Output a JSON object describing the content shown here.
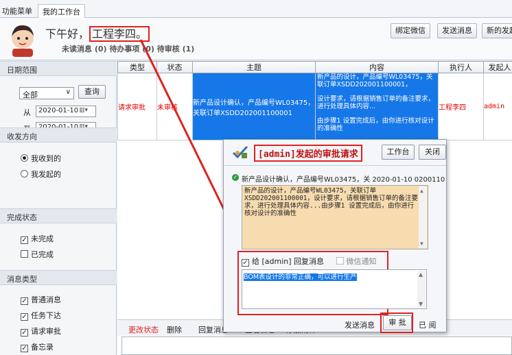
{
  "tabs": [
    {
      "label": "功能菜单"
    },
    {
      "label": "我的工作台"
    }
  ],
  "header": {
    "greeting": "下午好，",
    "username": "工程李四。",
    "stats": "未读消息 (0) 待办事项 (0)  待审核 (1)",
    "buttons": [
      "绑定微信",
      "发送消息",
      "新的发起"
    ]
  },
  "sidebar": {
    "date_range": {
      "title": "日期范围",
      "select_value": "全部",
      "query_label": "查询",
      "from_label": "从",
      "from_value": "2020-01-10",
      "to_label": "至",
      "to_value": "2020-01-10"
    },
    "direction": {
      "title": "收发方向",
      "options": [
        "我收到的",
        "我发起的"
      ],
      "selected": 0
    },
    "status": {
      "title": "完成状态",
      "options": [
        "未完成",
        "已完成"
      ],
      "checked": [
        true,
        false
      ]
    },
    "msg_type": {
      "title": "消息类型",
      "options": [
        "普通消息",
        "任务下达",
        "请求审批",
        "备忘录"
      ],
      "checked": [
        true,
        true,
        true,
        true
      ]
    }
  },
  "table": {
    "headers": [
      "类型",
      "状态",
      "主题",
      "内容",
      "执行人",
      "发起人"
    ],
    "rows": [
      {
        "type": "请求审批",
        "status": "未审核",
        "subject": "新产品设计确认，产品编号WL03475，关联订单XSDD202001100001",
        "content": [
          "新产品的设计，产品编号WL03475，关联订单XSDD202001100001，",
          "设计要求，请根据销售订单的备注要求，进行处理具体内容...",
          "由步骤1 设置完成后，由你进行核对设计的准确性"
        ],
        "executor": "工程李四",
        "initiator": "admin"
      }
    ]
  },
  "bottom": {
    "actions": [
      "更改状态",
      "删除",
      "回复消息",
      "查看日志",
      "添加附件"
    ]
  },
  "popup": {
    "title": "[admin]发起的审批请求",
    "btn_workbench": "工作台",
    "btn_close": "关闭",
    "info": "新产品设计确认，产品编号WL03475，关 2020-01-10 02001100",
    "message": "新产品的设计，产品编号WL03475，关联订单XSDD202001100001，设计要求，请根据销售订单的备注要求，进行处理具体内容...由步骤1 设置完成后，由你进行核对设计的准确性",
    "reply_label": "给 [admin] 回复消息",
    "wechat_label": "微信通知",
    "reply_text": "BOM表设计的非常正确，可以进行生产",
    "send_label": "发送消息",
    "approve_label": "审 批",
    "read_label": "已 阅"
  },
  "colors": {
    "accent": "#1677e8",
    "highlight": "#e02020",
    "memo_bg": "#f7dcb0"
  }
}
